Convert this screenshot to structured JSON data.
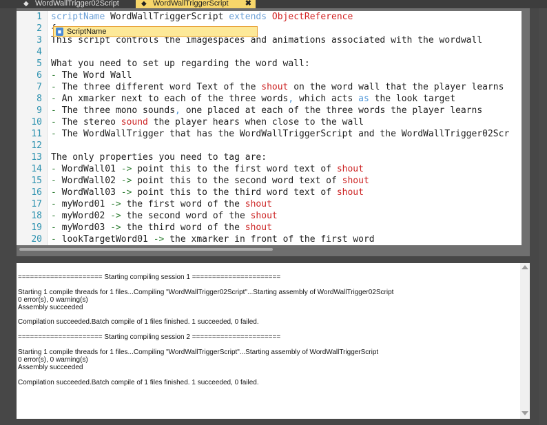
{
  "tabs": [
    {
      "label": "WordWallTrigger02Script"
    },
    {
      "label": "WordWallTriggerScript",
      "close": "✖"
    }
  ],
  "editor": {
    "line_numbers": [
      "1",
      "2",
      "3",
      "4",
      "5",
      "6",
      "7",
      "8",
      "9",
      "10",
      "11",
      "12",
      "13",
      "14",
      "15",
      "16",
      "17",
      "18",
      "19",
      "20"
    ],
    "lines": [
      [
        {
          "t": "scriptName ",
          "c": "kw"
        },
        {
          "t": "WordWallTriggerScript ",
          "c": "pl"
        },
        {
          "t": "extends ",
          "c": "kw"
        },
        {
          "t": "ObjectReference",
          "c": "ty"
        }
      ],
      [
        {
          "t": "{",
          "c": "pl"
        }
      ],
      [
        {
          "t": "This script controls the imagespaces and animations associated with the wordwall",
          "c": "pl"
        }
      ],
      [],
      [
        {
          "t": "What you need to set up regarding the word wall:",
          "c": "pl"
        }
      ],
      [
        {
          "t": "- ",
          "c": "cm"
        },
        {
          "t": "The Word Wall",
          "c": "pl"
        }
      ],
      [
        {
          "t": "- ",
          "c": "cm"
        },
        {
          "t": "The three different word Text of the ",
          "c": "pl"
        },
        {
          "t": "shout",
          "c": "hot"
        },
        {
          "t": " on the word wall that the player learns",
          "c": "pl"
        }
      ],
      [
        {
          "t": "- ",
          "c": "cm"
        },
        {
          "t": "An xmarker next to each of the three words",
          "c": "pl"
        },
        {
          "t": ", ",
          "c": "blue"
        },
        {
          "t": "which acts ",
          "c": "pl"
        },
        {
          "t": "as",
          "c": "blue"
        },
        {
          "t": " the look target",
          "c": "pl"
        }
      ],
      [
        {
          "t": "- ",
          "c": "cm"
        },
        {
          "t": "The three mono sounds",
          "c": "pl"
        },
        {
          "t": ", ",
          "c": "blue"
        },
        {
          "t": "one placed at each of the three words the player learns",
          "c": "pl"
        }
      ],
      [
        {
          "t": "- ",
          "c": "cm"
        },
        {
          "t": "The stereo ",
          "c": "pl"
        },
        {
          "t": "sound",
          "c": "hot"
        },
        {
          "t": " the player hears when close to the wall",
          "c": "pl"
        }
      ],
      [
        {
          "t": "- ",
          "c": "cm"
        },
        {
          "t": "The WordWallTrigger that has the WordWallTriggerScript and the WordWallTrigger02Scr",
          "c": "pl"
        }
      ],
      [],
      [
        {
          "t": "The only properties you need to tag are:",
          "c": "pl"
        }
      ],
      [
        {
          "t": "- ",
          "c": "cm"
        },
        {
          "t": "WordWall01 ",
          "c": "pl"
        },
        {
          "t": "-> ",
          "c": "cm"
        },
        {
          "t": "point this to the first word text of ",
          "c": "pl"
        },
        {
          "t": "shout",
          "c": "hot"
        }
      ],
      [
        {
          "t": "- ",
          "c": "cm"
        },
        {
          "t": "WordWall02 ",
          "c": "pl"
        },
        {
          "t": "-> ",
          "c": "cm"
        },
        {
          "t": "point this to the second word text of ",
          "c": "pl"
        },
        {
          "t": "shout",
          "c": "hot"
        }
      ],
      [
        {
          "t": "- ",
          "c": "cm"
        },
        {
          "t": "WordWall03 ",
          "c": "pl"
        },
        {
          "t": "-> ",
          "c": "cm"
        },
        {
          "t": "point this to the third word text of ",
          "c": "pl"
        },
        {
          "t": "shout",
          "c": "hot"
        }
      ],
      [
        {
          "t": "- ",
          "c": "cm"
        },
        {
          "t": "myWord01 ",
          "c": "pl"
        },
        {
          "t": "-> ",
          "c": "cm"
        },
        {
          "t": "the first word of the ",
          "c": "pl"
        },
        {
          "t": "shout",
          "c": "hot"
        }
      ],
      [
        {
          "t": "- ",
          "c": "cm"
        },
        {
          "t": "myWord02 ",
          "c": "pl"
        },
        {
          "t": "-> ",
          "c": "cm"
        },
        {
          "t": "the second word of the ",
          "c": "pl"
        },
        {
          "t": "shout",
          "c": "hot"
        }
      ],
      [
        {
          "t": "- ",
          "c": "cm"
        },
        {
          "t": "myWord03 ",
          "c": "pl"
        },
        {
          "t": "-> ",
          "c": "cm"
        },
        {
          "t": "the third word of the ",
          "c": "pl"
        },
        {
          "t": "shout",
          "c": "hot"
        }
      ],
      [
        {
          "t": "- ",
          "c": "cm"
        },
        {
          "t": "lookTargetWord01 ",
          "c": "pl"
        },
        {
          "t": "-> ",
          "c": "cm"
        },
        {
          "t": "the xmarker in front of the first word",
          "c": "pl"
        }
      ]
    ]
  },
  "autocomplete": {
    "item": "ScriptName"
  },
  "output": {
    "lines": [
      "===================== Starting compiling session 1 ======================",
      "",
      "Starting 1 compile threads for 1 files...Compiling \"WordWallTrigger02Script\"...Starting assembly of WordWallTrigger02Script",
      "0 error(s), 0 warning(s)",
      "Assembly succeeded",
      "",
      "Compilation succeeded.Batch compile of 1 files finished. 1 succeeded, 0 failed.",
      "",
      "===================== Starting compiling session 2 ======================",
      "",
      "Starting 1 compile threads for 1 files...Compiling \"WordWallTriggerScript\"...Starting assembly of WordWallTriggerScript",
      "0 error(s), 0 warning(s)",
      "Assembly succeeded",
      "",
      "Compilation succeeded.Batch compile of 1 files finished. 1 succeeded, 0 failed."
    ]
  },
  "colors": {
    "active_tab": "#f7d66a",
    "keyword": "#6a9fd6",
    "type": "#d11f1f",
    "line_number": "#2b91af"
  },
  "icons": {
    "tab": "script-icon",
    "autocomplete": "property-icon"
  }
}
